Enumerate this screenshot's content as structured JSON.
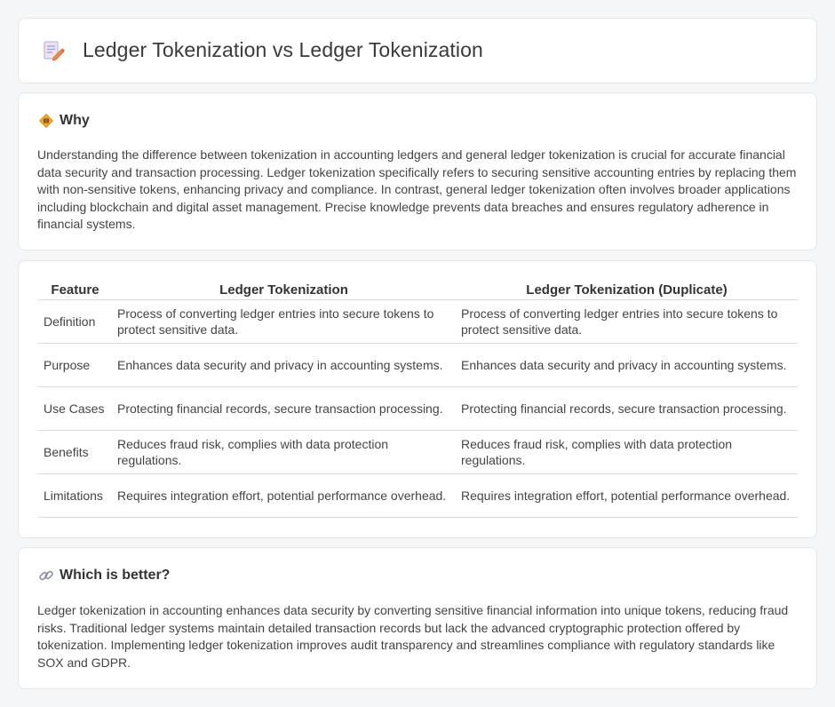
{
  "header": {
    "title": "Ledger Tokenization vs Ledger Tokenization",
    "icon": "document-edit-icon"
  },
  "why": {
    "title": "Why",
    "icon": "diamond-warning-icon",
    "text": "Understanding the difference between tokenization in accounting ledgers and general ledger tokenization is crucial for accurate financial data security and transaction processing. Ledger tokenization specifically refers to securing sensitive accounting entries by replacing them with non-sensitive tokens, enhancing privacy and compliance. In contrast, general ledger tokenization often involves broader applications including blockchain and digital asset management. Precise knowledge prevents data breaches and ensures regulatory adherence in financial systems."
  },
  "comparison": {
    "headers": [
      "Feature",
      "Ledger Tokenization",
      "Ledger Tokenization (Duplicate)"
    ],
    "rows": [
      {
        "feature": "Definition",
        "a": "Process of converting ledger entries into secure tokens to protect sensitive data.",
        "b": "Process of converting ledger entries into secure tokens to protect sensitive data."
      },
      {
        "feature": "Purpose",
        "a": "Enhances data security and privacy in accounting systems.",
        "b": "Enhances data security and privacy in accounting systems."
      },
      {
        "feature": "Use Cases",
        "a": "Protecting financial records, secure transaction processing.",
        "b": "Protecting financial records, secure transaction processing."
      },
      {
        "feature": "Benefits",
        "a": "Reduces fraud risk, complies with data protection regulations.",
        "b": "Reduces fraud risk, complies with data protection regulations."
      },
      {
        "feature": "Limitations",
        "a": "Requires integration effort, potential performance overhead.",
        "b": "Requires integration effort, potential performance overhead."
      }
    ]
  },
  "better": {
    "title": "Which is better?",
    "icon": "link-icon",
    "text": "Ledger tokenization in accounting enhances data security by converting sensitive financial information into unique tokens, reducing fraud risks. Traditional ledger systems maintain detailed transaction records but lack the advanced cryptographic protection offered by tokenization. Implementing ledger tokenization improves audit transparency and streamlines compliance with regulatory standards like SOX and GDPR."
  },
  "colors": {
    "background": "#f5f6f8",
    "card": "#ffffff",
    "border": "#e4e6ea",
    "icon_accent": "#f0a030"
  }
}
